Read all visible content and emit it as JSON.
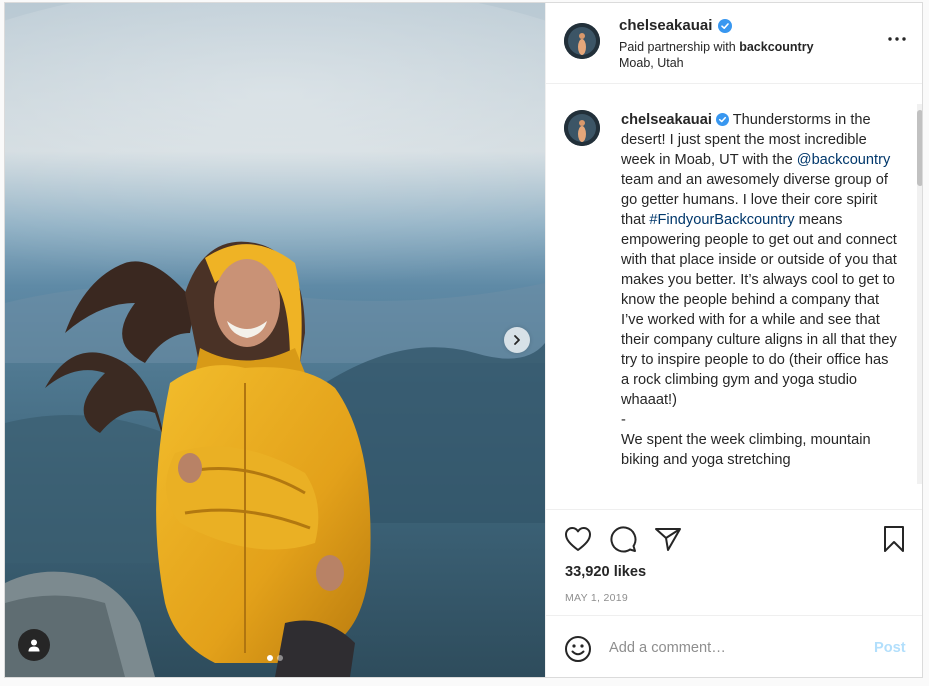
{
  "post": {
    "username": "chelseakauai",
    "paid_prefix": "Paid partnership with ",
    "partner": "backcountry",
    "location": "Moab, Utah"
  },
  "caption": {
    "username": "chelseakauai",
    "part1": " Thunderstorms in the desert! I just spent the most incredible week in Moab, UT with the ",
    "mention": "@backcountry",
    "part2": " team and an awesomely diverse group of go getter humans. I love their core spirit that ",
    "hashtag": "#FindyourBackcountry",
    "part3": " means empowering people to get out and connect with that place inside or outside of you that makes you better. It’s always cool to get to know the people behind a company that I’ve worked with for a while and see that their company culture aligns in all that they try to inspire people to do (their office has a rock climbing gym and yoga studio whaaat!)",
    "separator": "-",
    "part4": "We spent the week climbing, mountain biking and yoga stretching"
  },
  "likes": "33,920 likes",
  "date": "MAY 1, 2019",
  "comment_box": {
    "placeholder": "Add a comment…",
    "post_label": "Post"
  },
  "carousel": {
    "slide_count": 2,
    "current_slide": 1
  },
  "icons": {
    "verified": "verified-badge-icon",
    "more": "more-options-icon",
    "like": "heart-icon",
    "comment": "comment-bubble-icon",
    "share": "paper-plane-icon",
    "save": "bookmark-icon",
    "emoji": "emoji-smile-icon",
    "next": "chevron-right-icon",
    "tag": "user-tag-icon"
  },
  "colors": {
    "link": "#00376b",
    "verified": "#3897f0",
    "post_disabled": "#b2dffc",
    "jacket": "#e8a81c"
  }
}
